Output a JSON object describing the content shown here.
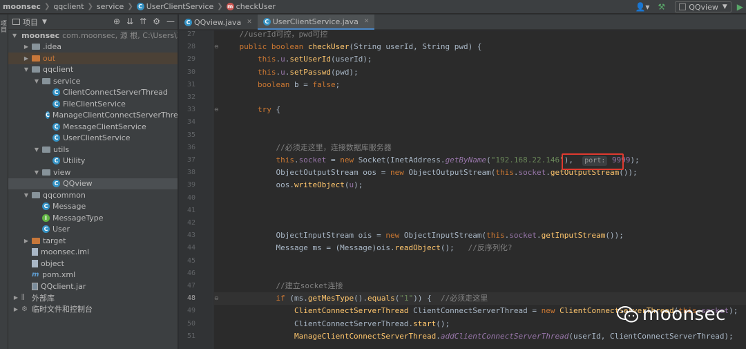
{
  "breadcrumb": {
    "project": "moonsec",
    "module": "qqclient",
    "package": "service",
    "class": "UserClientService",
    "method": "checkUser"
  },
  "toolbar": {
    "run_config": "QQview"
  },
  "project_panel": {
    "title": "项目",
    "strip_label": "项目",
    "tree": [
      {
        "label": "moonsec",
        "extra": "com.moonsec, 源 根, C:\\Users\\耿",
        "depth": 0,
        "type": "module",
        "expanded": true
      },
      {
        "label": ".idea",
        "depth": 1,
        "type": "folder",
        "expanded": false
      },
      {
        "label": "out",
        "depth": 1,
        "type": "folder-orange",
        "expanded": false
      },
      {
        "label": "qqclient",
        "depth": 1,
        "type": "folder",
        "expanded": true
      },
      {
        "label": "service",
        "depth": 2,
        "type": "folder",
        "expanded": true
      },
      {
        "label": "ClientConnectServerThread",
        "depth": 3,
        "type": "class"
      },
      {
        "label": "FileClientService",
        "depth": 3,
        "type": "class"
      },
      {
        "label": "ManageClientConnectServerThrea",
        "depth": 3,
        "type": "class"
      },
      {
        "label": "MessageClientService",
        "depth": 3,
        "type": "class"
      },
      {
        "label": "UserClientService",
        "depth": 3,
        "type": "class"
      },
      {
        "label": "utils",
        "depth": 2,
        "type": "folder",
        "expanded": true
      },
      {
        "label": "Utility",
        "depth": 3,
        "type": "class"
      },
      {
        "label": "view",
        "depth": 2,
        "type": "folder",
        "expanded": true
      },
      {
        "label": "QQview",
        "depth": 3,
        "type": "class",
        "selected": true
      },
      {
        "label": "qqcommon",
        "depth": 1,
        "type": "folder",
        "expanded": true
      },
      {
        "label": "Message",
        "depth": 2,
        "type": "class"
      },
      {
        "label": "MessageType",
        "depth": 2,
        "type": "interface"
      },
      {
        "label": "User",
        "depth": 2,
        "type": "class"
      },
      {
        "label": "target",
        "depth": 1,
        "type": "folder-orange",
        "expanded": false
      },
      {
        "label": "moonsec.iml",
        "depth": 1,
        "type": "file"
      },
      {
        "label": "object",
        "depth": 1,
        "type": "file"
      },
      {
        "label": "pom.xml",
        "depth": 1,
        "type": "maven"
      },
      {
        "label": "QQclient.jar",
        "depth": 1,
        "type": "jar"
      },
      {
        "label": "外部库",
        "depth": 0,
        "type": "lib",
        "expanded": false
      },
      {
        "label": "临时文件和控制台",
        "depth": 0,
        "type": "scratch",
        "expanded": false
      }
    ]
  },
  "tabs": [
    {
      "label": "QQview.java",
      "active": false
    },
    {
      "label": "UserClientService.java",
      "active": true
    }
  ],
  "editor": {
    "current_line": 48,
    "hint_label": "port:",
    "lines": [
      {
        "n": "27",
        "html": "<span class=\"cm\">    //userId可控，pwd可控</span>"
      },
      {
        "n": "28",
        "html": "    <span class=\"kw\">public boolean </span><span class=\"fn\">checkUser</span>(String userId, String pwd) {"
      },
      {
        "n": "29",
        "html": "        <span class=\"kw\">this</span>.<span class=\"fld\">u</span>.<span class=\"mth\">setUserId</span>(userId);"
      },
      {
        "n": "30",
        "html": "        <span class=\"kw\">this</span>.<span class=\"fld\">u</span>.<span class=\"mth\">setPasswd</span>(pwd);"
      },
      {
        "n": "31",
        "html": "        <span class=\"kw\">boolean </span>b = <span class=\"kw\">false</span>;"
      },
      {
        "n": "32",
        "html": ""
      },
      {
        "n": "33",
        "html": "        <span class=\"kw\">try </span>{"
      },
      {
        "n": "34",
        "html": ""
      },
      {
        "n": "35",
        "html": ""
      },
      {
        "n": "36",
        "html": "<span class=\"cm\">            //必须走这里，连接数据库服务器</span>"
      },
      {
        "n": "37",
        "html": "            <span class=\"kw\">this</span>.<span class=\"fld\">socket </span>= <span class=\"kw\">new </span>Socket(InetAddress.<span class=\"st\">getByName</span>(<span class=\"str\">\"192.168.22.146\"</span>),  <span class=\"hint\">port:</span> <span class=\"fld\">9999</span>);"
      },
      {
        "n": "38",
        "html": "            ObjectOutputStream oos = <span class=\"kw\">new </span>ObjectOutputStream(<span class=\"kw\">this</span>.<span class=\"fld\">socket</span>.<span class=\"mth\">getOutputStream</span>());"
      },
      {
        "n": "39",
        "html": "            oos.<span class=\"mth\">writeObject</span>(<span class=\"fld\">u</span>);"
      },
      {
        "n": "40",
        "html": ""
      },
      {
        "n": "41",
        "html": ""
      },
      {
        "n": "42",
        "html": ""
      },
      {
        "n": "43",
        "html": "            ObjectInputStream ois = <span class=\"kw\">new </span>ObjectInputStream(<span class=\"kw\">this</span>.<span class=\"fld\">socket</span>.<span class=\"mth\">getInputStream</span>());"
      },
      {
        "n": "44",
        "html": "            Message ms = (Message)ois.<span class=\"mth\">readObject</span>();   <span class=\"cm\">//反序列化?</span>"
      },
      {
        "n": "45",
        "html": ""
      },
      {
        "n": "46",
        "html": ""
      },
      {
        "n": "47",
        "html": "<span class=\"cm\">            //建立socket连接</span>"
      },
      {
        "n": "48",
        "html": "            <span class=\"kw\">if </span>(ms.<span class=\"mth\">getMesType</span>().<span class=\"mth\">equals</span>(<span class=\"str\">\"1\"</span>)) {  <span class=\"cm\">//必须走这里</span>"
      },
      {
        "n": "49",
        "html": "                <span class=\"fn\">ClientConnectServerThread </span>ClientConnectServerThread = <span class=\"kw\">new </span><span class=\"fn\">ClientConnectServerThread</span>(<span class=\"kw\">this</span>.<span class=\"fld\">socket</span>);"
      },
      {
        "n": "50",
        "html": "                ClientConnectServerThread.<span class=\"mth\">start</span>();"
      },
      {
        "n": "51",
        "html": "                <span class=\"fn\">ManageClientConnectServerThread</span>.<span class=\"st\">addClientConnectServerThread</span>(userId, ClientConnectServerThread);"
      }
    ]
  },
  "watermark": {
    "text": "moonsec"
  }
}
